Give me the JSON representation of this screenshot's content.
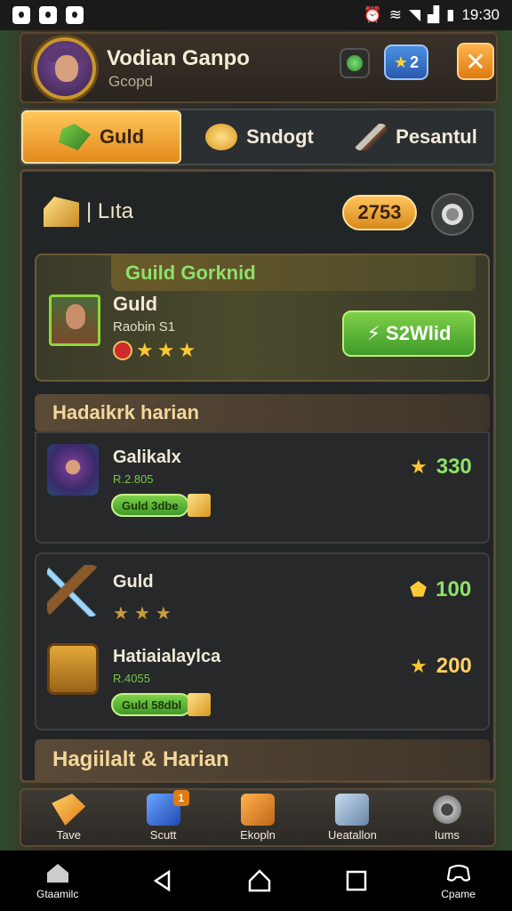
{
  "status_bar": {
    "time": "19:30"
  },
  "profile": {
    "name": "Vodian Ganpo",
    "subtitle": "Gcopd",
    "star_count": "2"
  },
  "tabs": [
    {
      "label": "Guld",
      "active": true,
      "icon": "leaf-icon"
    },
    {
      "label": "Sndogt",
      "active": false,
      "icon": "shield-icon"
    },
    {
      "label": "Pesantul",
      "active": false,
      "icon": "sword-icon"
    }
  ],
  "panel": {
    "level_label": "| Lıta",
    "coins": "2753",
    "guild_card": {
      "title": "Guild Gorknid",
      "name": "Guld",
      "meta": "Raobin S1",
      "join_label": "S2Wlid"
    },
    "section1_title": "Hadaikrk harian",
    "items": [
      {
        "name": "Galikalx",
        "subtitle": "R.2.805",
        "tag": "Guld 3dbe",
        "reward": "330"
      },
      {
        "name": "Guld",
        "reward": "100"
      },
      {
        "name": "Hatiaialaylca",
        "subtitle": "R.4055",
        "tag": "Guld 58dbl",
        "reward": "200"
      }
    ],
    "section2_title": "Hagiilalt & Harian"
  },
  "bottom_nav": [
    {
      "label": "Tave",
      "icon": "flag-icon"
    },
    {
      "label": "Scutt",
      "icon": "cube-icon",
      "badge": "1"
    },
    {
      "label": "Ekopln",
      "icon": "chest-icon"
    },
    {
      "label": "Ueatallon",
      "icon": "gem-cube-icon"
    },
    {
      "label": "Iums",
      "icon": "gear-icon"
    }
  ],
  "system_nav": {
    "home_label": "Gtaamilc",
    "game_label": "Cpame"
  },
  "colors": {
    "accent": "#f0a22a",
    "success": "#5cb83a",
    "panel": "#222526"
  }
}
